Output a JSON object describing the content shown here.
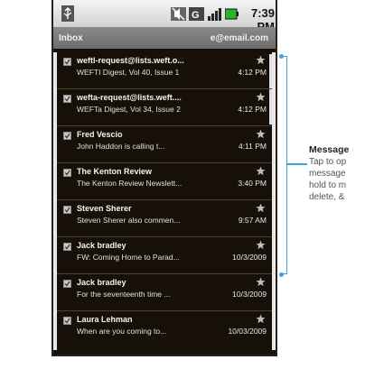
{
  "statusbar": {
    "time": "7:39 PM"
  },
  "titlebar": {
    "label": "Inbox",
    "email": "e@email.com"
  },
  "messages": [
    {
      "sender": "weftl-request@lists.weft.o...",
      "snippet": "WEFTI Digest, Vol 40, Issue 1",
      "time": "4:12 PM"
    },
    {
      "sender": "wefta-request@lists.weft....",
      "snippet": "WEFTa Digest, Vol 34, Issue 2",
      "time": "4:12 PM"
    },
    {
      "sender": "Fred Vescio",
      "snippet": "John Haddon is calling t...",
      "time": "4:11 PM"
    },
    {
      "sender": "The Kenton Review",
      "snippet": "The Kenton Review Newslett...",
      "time": "3:40 PM"
    },
    {
      "sender": "Steven Sherer",
      "snippet": "Steven Sherer also commen...",
      "time": "9:57 AM"
    },
    {
      "sender": "Jack bradley",
      "snippet": "FW: Coming Home to Parad...",
      "time": "10/3/2009"
    },
    {
      "sender": "Jack bradley",
      "snippet": "For the seventeenth time ...",
      "time": "10/3/2009"
    },
    {
      "sender": "Laura Lehman",
      "snippet": "When are you coming to...",
      "time": "10/03/2009"
    }
  ],
  "callout": {
    "heading": "Message",
    "lines": [
      "Tap to op",
      "message",
      "hold to m",
      "delete, &"
    ]
  },
  "colors": {
    "accent": "#3aa6e0",
    "battery": "#2bb52b"
  },
  "icons": [
    "usb-icon",
    "mute-icon",
    "data-icon",
    "signal-icon",
    "battery-icon",
    "star-icon",
    "checkbox-icon"
  ]
}
